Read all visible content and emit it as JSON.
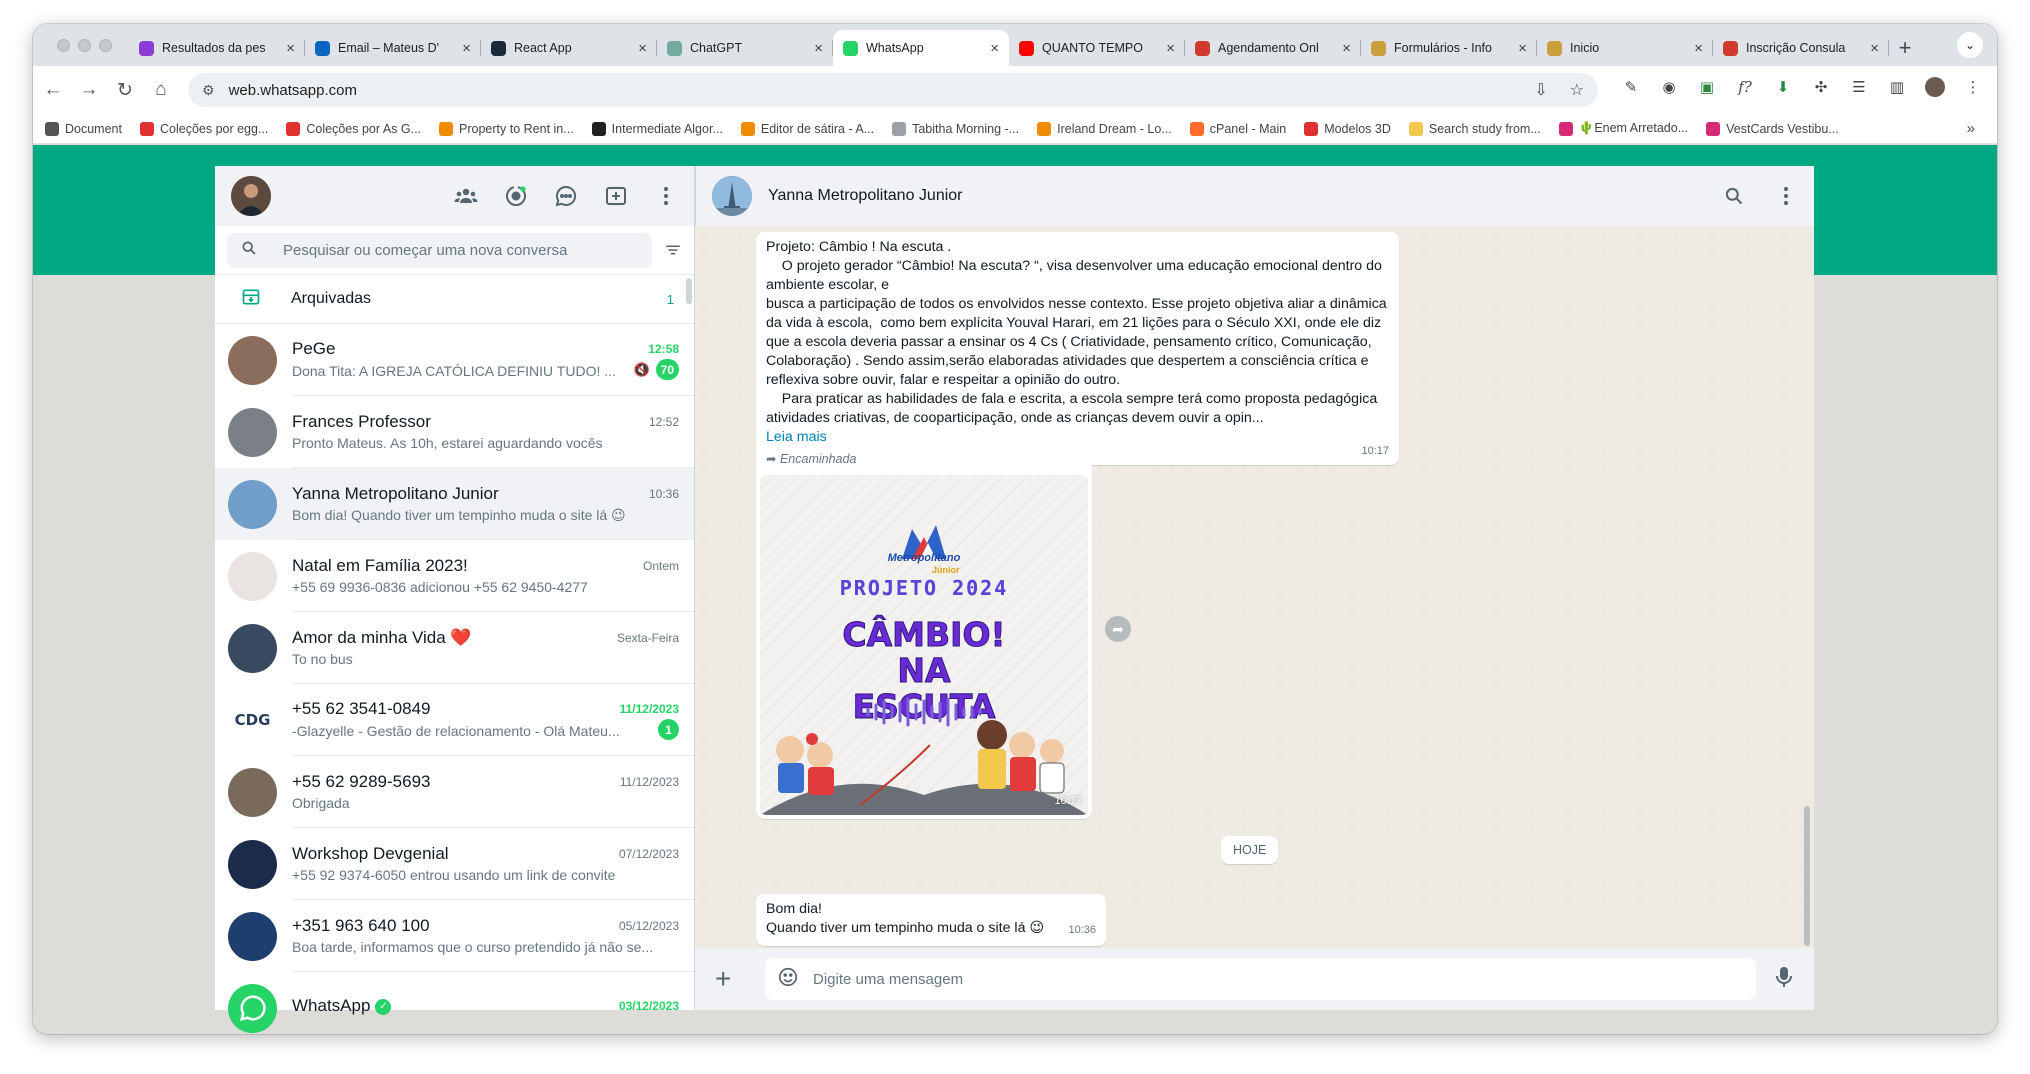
{
  "browser": {
    "tabs": [
      {
        "title": "Resultados da pes",
        "color": "#8b3dd6"
      },
      {
        "title": "Email – Mateus D'",
        "color": "#0a64c2"
      },
      {
        "title": "React App",
        "color": "#1b2a3a"
      },
      {
        "title": "ChatGPT",
        "color": "#74aa9c"
      },
      {
        "title": "WhatsApp",
        "color": "#25d366"
      },
      {
        "title": "QUANTO TEMPO",
        "color": "#ff0000"
      },
      {
        "title": "Agendamento Onl",
        "color": "#cf3b2c"
      },
      {
        "title": "Formulários - Info",
        "color": "#c8a13a"
      },
      {
        "title": "Inicio",
        "color": "#c8a13a"
      },
      {
        "title": "Inscrição Consula",
        "color": "#cf3b2c"
      }
    ],
    "url": "web.whatsapp.com",
    "bookmarks": [
      {
        "title": "Document",
        "color": "#555555"
      },
      {
        "title": "Coleções por egg...",
        "color": "#e03131"
      },
      {
        "title": "Coleções por As G...",
        "color": "#e03131"
      },
      {
        "title": "Property to Rent in...",
        "color": "#f08c00"
      },
      {
        "title": "Intermediate Algor...",
        "color": "#222222"
      },
      {
        "title": "Editor de sátira - A...",
        "color": "#f08c00"
      },
      {
        "title": "Tabitha Morning -...",
        "color": "#9aa0a6"
      },
      {
        "title": "Ireland Dream - Lo...",
        "color": "#f08c00"
      },
      {
        "title": "cPanel - Main",
        "color": "#ff6c2c"
      },
      {
        "title": "Modelos 3D",
        "color": "#e03131"
      },
      {
        "title": "Search study from...",
        "color": "#f2c94c"
      },
      {
        "title": "🌵Enem Arretado...",
        "color": "#d62976"
      },
      {
        "title": "VestCards Vestibu...",
        "color": "#d62976"
      }
    ]
  },
  "sidebar": {
    "search_placeholder": "Pesquisar ou começar uma nova conversa",
    "archived_label": "Arquivadas",
    "archived_count": "1",
    "chats": [
      {
        "name": "PeGe",
        "time": "12:58",
        "message": "Dona Tita: A IGREJA CATÓLICA DEFINIU TUDO! ...",
        "badge": "70",
        "muted": true,
        "time_unread": true,
        "color": "#8a6d5a"
      },
      {
        "name": "Frances Professor",
        "time": "12:52",
        "message": "Pronto Mateus. As 10h, estarei aguardando vocês",
        "badge": "",
        "color": "#7b7f86"
      },
      {
        "name": "Yanna Metropolitano Junior",
        "time": "10:36",
        "message": "Bom dia! Quando tiver um tempinho muda o site lá 😉",
        "badge": "",
        "color": "#6f9fc8"
      },
      {
        "name": "Natal em Família 2023!",
        "time": "Ontem",
        "message": "+55 69 9936-0836 adicionou +55 62 9450-4277",
        "badge": "",
        "color": "#e9e4e1"
      },
      {
        "name": "Amor da minha Vida ❤️",
        "time": "Sexta-Feira",
        "message": "To no bus",
        "badge": "",
        "color": "#3a4a5e"
      },
      {
        "name": "+55 62 3541-0849",
        "time": "11/12/2023",
        "message": "-Glazyelle - Gestão de relacionamento  - Olá Mateu...",
        "badge": "1",
        "time_unread": true,
        "color": "#ffffff"
      },
      {
        "name": "+55 62 9289-5693",
        "time": "11/12/2023",
        "message": "Obrigada",
        "badge": "",
        "color": "#7a6a5c"
      },
      {
        "name": "Workshop Devgenial",
        "time": "07/12/2023",
        "message": "+55 92 9374-6050 entrou usando um link de convite",
        "badge": "",
        "color": "#1c2b4a"
      },
      {
        "name": "+351 963 640 100",
        "time": "05/12/2023",
        "message": "Boa tarde, informamos que o curso pretendido já não se...",
        "badge": "",
        "color": "#1e3e6e"
      },
      {
        "name": "WhatsApp",
        "time": "03/12/2023",
        "message": "",
        "badge": "",
        "time_unread": true,
        "verified": true,
        "color": "#25d366"
      }
    ]
  },
  "conversation": {
    "contact_name": "Yanna Metropolitano Junior",
    "message1": {
      "text": "Projeto: Câmbio ! Na escuta .\n    O projeto gerador “Câmbio! Na escuta? “, visa desenvolver uma educação emocional dentro do ambiente escolar, e\nbusca a participação de todos os envolvidos nesse contexto. Esse projeto objetiva aliar a dinâmica da vida à escola,  como bem explícita Youval Harari, em 21 lições para o Século XXI, onde ele diz que a escola deveria passar a ensinar os 4 Cs ( Criatividade, pensamento crítico, Comunicação, Colaboração) . Sendo assim,serão elaboradas atividades que despertem a consciência crítica e reflexiva sobre ouvir, falar e respeitar a opinião do outro.\n    Para praticar as habilidades de fala e escrita, a escola sempre terá como proposta pedagógica atividades criativas, de cooparticipação, onde as crianças devem ouvir a opin...",
      "read_more": "Leia mais",
      "time": "10:17"
    },
    "message2": {
      "forwarded_label": "Encaminhada",
      "poster_brand": "Metropolitano",
      "poster_brand_sub": "Júnior",
      "poster_year": "PROJETO 2024",
      "poster_title_1": "CÂMBIO!",
      "poster_title_2": "NA",
      "poster_title_3": "ESCUTA",
      "time": "10:17"
    },
    "day_separator": "HOJE",
    "message3": {
      "line1": "Bom dia!",
      "line2": "Quando tiver um tempinho muda o site lá 😉",
      "time": "10:36"
    },
    "compose_placeholder": "Digite uma mensagem"
  },
  "colors": {
    "brand": "#00a884",
    "unread": "#25d366",
    "link": "#027eb5"
  }
}
